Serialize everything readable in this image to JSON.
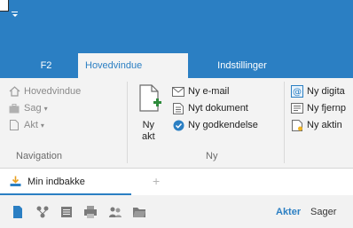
{
  "tabs": [
    {
      "label": "F2"
    },
    {
      "label": "Hovedvindue"
    },
    {
      "label": "Indstillinger"
    }
  ],
  "ribbon": {
    "navigation": {
      "items": [
        "Hovedvindue",
        "Sag",
        "Akt"
      ],
      "group_label": "Navigation"
    },
    "new_akt": {
      "line1": "Ny",
      "line2": "akt"
    },
    "new_items": [
      "Ny e-mail",
      "Nyt dokument",
      "Ny godkendelse"
    ],
    "right_items": [
      "Ny digita",
      "Ny fjernp",
      "Ny aktin"
    ],
    "right_group_label": "Ny"
  },
  "doc_tab": {
    "label": "Min indbakke",
    "add": "+"
  },
  "toolbar": {
    "link_akter": "Akter",
    "link_sager": "Sager"
  },
  "colors": {
    "brand": "#2b7fc3",
    "ribbon_bg": "#f3f3f3",
    "text": "#222222",
    "dim_text": "#8a8a8a"
  }
}
